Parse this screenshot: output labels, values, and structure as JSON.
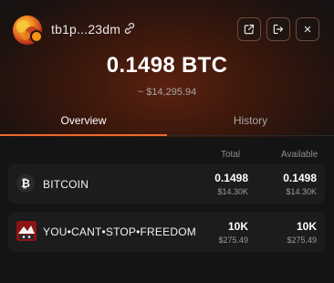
{
  "header": {
    "address": "tb1p...23dm",
    "icons": {
      "copy": "copy-link-icon",
      "open": "external-link-icon",
      "logout": "logout-icon",
      "close": "close-icon"
    },
    "close_symbol": "×"
  },
  "balance": {
    "amount": "0.1498 BTC",
    "fiat": "~ $14,295.94"
  },
  "tabs": [
    {
      "label": "Overview",
      "active": true
    },
    {
      "label": "History",
      "active": false
    }
  ],
  "table": {
    "columns": {
      "total": "Total",
      "available": "Available"
    },
    "rows": [
      {
        "icon_letter": "₿",
        "name": "BITCOIN",
        "total": "0.1498",
        "total_fiat": "$14.30K",
        "available": "0.1498",
        "available_fiat": "$14.30K"
      },
      {
        "name": "YOU•CANT•STOP•FREEDOM",
        "total": "10K",
        "total_fiat": "$275.49",
        "available": "10K",
        "available_fiat": "$275.49"
      }
    ]
  },
  "colors": {
    "accent": "#ea6a2c",
    "background": "#141414",
    "row_bg": "#1c1c1c"
  }
}
